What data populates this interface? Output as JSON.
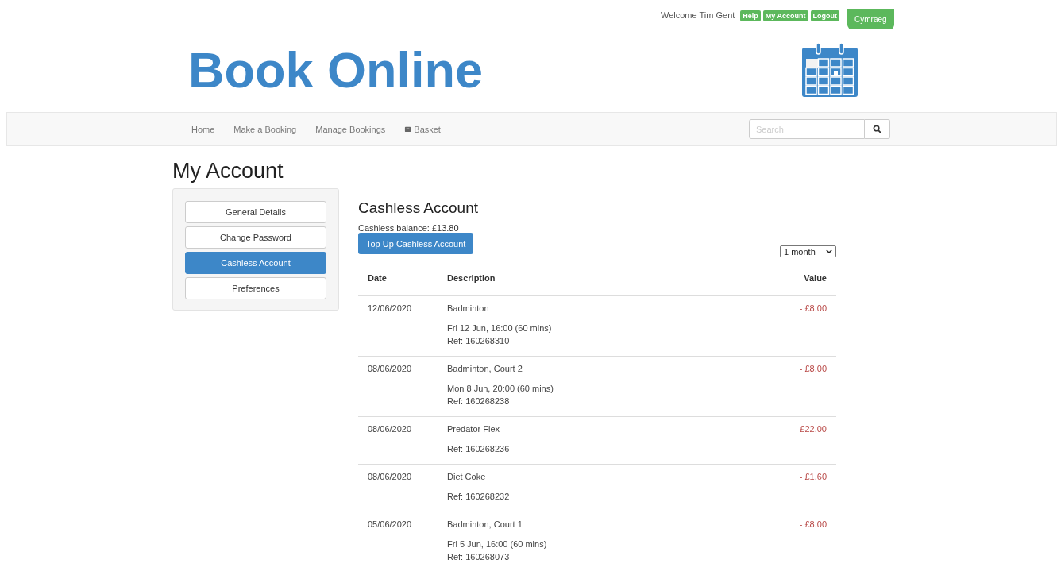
{
  "topbar": {
    "welcome": "Welcome Tim Gent",
    "links": [
      "Help",
      "My Account",
      "Logout"
    ],
    "language_button": "Cymraeg"
  },
  "header": {
    "title": "Book Online"
  },
  "nav": {
    "items": [
      {
        "label": "Home",
        "icon": false
      },
      {
        "label": "Make a Booking",
        "icon": false
      },
      {
        "label": "Manage Bookings",
        "icon": false
      },
      {
        "label": "Basket",
        "icon": true
      }
    ],
    "search": {
      "placeholder": "Search"
    }
  },
  "page_title": "My Account",
  "sidebar": {
    "items": [
      {
        "label": "General Details",
        "selected": false
      },
      {
        "label": "Change Password",
        "selected": false
      },
      {
        "label": "Cashless Account",
        "selected": true
      },
      {
        "label": "Preferences",
        "selected": false
      }
    ]
  },
  "content": {
    "title": "Cashless Account",
    "balance": "Cashless balance: £13.80",
    "top_up_button": "Top Up Cashless Account",
    "period_select": "1 month",
    "table": {
      "columns": [
        "Date",
        "Description",
        "Value"
      ],
      "rows": [
        {
          "date": "12/06/2020",
          "description": "Badminton",
          "details": [
            "Fri 12 Jun, 16:00 (60 mins)",
            "Ref: 160268310"
          ],
          "value": "- £8.00"
        },
        {
          "date": "08/06/2020",
          "description": "Badminton, Court 2",
          "details": [
            "Mon 8 Jun, 20:00 (60 mins)",
            "Ref: 160268238"
          ],
          "value": "- £8.00"
        },
        {
          "date": "08/06/2020",
          "description": "Predator Flex",
          "details": [
            "Ref: 160268236"
          ],
          "value": "- £22.00"
        },
        {
          "date": "08/06/2020",
          "description": "Diet Coke",
          "details": [
            "Ref: 160268232"
          ],
          "value": "- £1.60"
        },
        {
          "date": "05/06/2020",
          "description": "Badminton, Court 1",
          "details": [
            "Fri 5 Jun, 16:00 (60 mins)",
            "Ref: 160268073"
          ],
          "value": "- £8.00"
        }
      ]
    }
  }
}
